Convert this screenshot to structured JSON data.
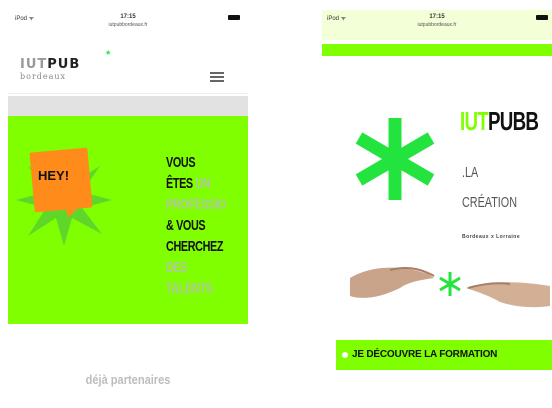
{
  "left_screen": {
    "status_bar": {
      "carrier": "iPod ᯤ",
      "time": "17:15",
      "url": "iutpubbordeaux.fr"
    },
    "logo": {
      "iut": "IUT",
      "pub": "PUB",
      "star": "*",
      "subtitle": "bordeaux"
    },
    "hero": {
      "badge": "HEY!",
      "lines": [
        {
          "text": "VOUS",
          "tone": "dark"
        },
        {
          "text": "ÊTES ",
          "tone": "dark",
          "extra": "UN"
        },
        {
          "text": "PROFESSIO",
          "tone": "light"
        },
        {
          "text": "& VOUS",
          "tone": "dark"
        },
        {
          "text": "CHERCHEZ",
          "tone": "dark"
        },
        {
          "text": "DES",
          "tone": "light"
        },
        {
          "text": "TALENTS",
          "tone": "light"
        }
      ]
    },
    "partners_text": "déjà partenaires"
  },
  "right_screen": {
    "status_bar": {
      "carrier": "iPod ᯤ",
      "time": "17:15",
      "url": "iutpubbordeaux.fr"
    },
    "brand": {
      "iut": "IUT",
      "pub": "PUB",
      "cut": "B"
    },
    "tagline_1": ".LA",
    "tagline_2": "CRÉATION",
    "small_text": "Bordeaux x Lorraine",
    "cta_label": "JE DÉCOUVRE LA FORMATION"
  },
  "colors": {
    "accent_green": "#7fff00",
    "asterisk_green": "#23e33f",
    "badge_orange": "#ff8c1a"
  }
}
